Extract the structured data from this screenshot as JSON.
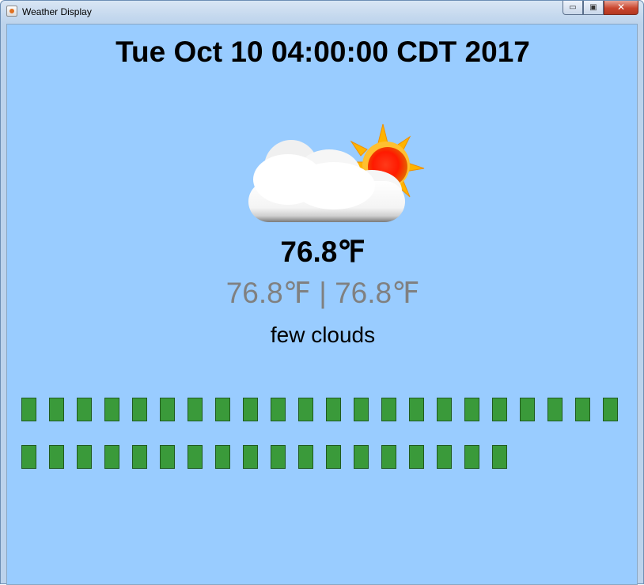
{
  "window": {
    "title": "Weather Display",
    "app_icon": "java-cup-icon",
    "controls": {
      "minimize_icon": "minimize-icon",
      "maximize_icon": "maximize-icon",
      "close_icon": "close-icon",
      "minimize_glyph": "▭",
      "maximize_glyph": "▣",
      "close_glyph": "✕"
    }
  },
  "display": {
    "datetime": "Tue Oct 10 04:00:00 CDT 2017",
    "weather_icon": "few-clouds-day-icon",
    "temperature": "76.8℉",
    "temperature_range": "76.8℉ | 76.8℉",
    "condition": "few clouds"
  },
  "indicators": {
    "block_color": "#3a9a3a",
    "row1_count": 22,
    "row2_count": 18
  },
  "colors": {
    "background": "#99ccff",
    "range_text": "#808080"
  }
}
